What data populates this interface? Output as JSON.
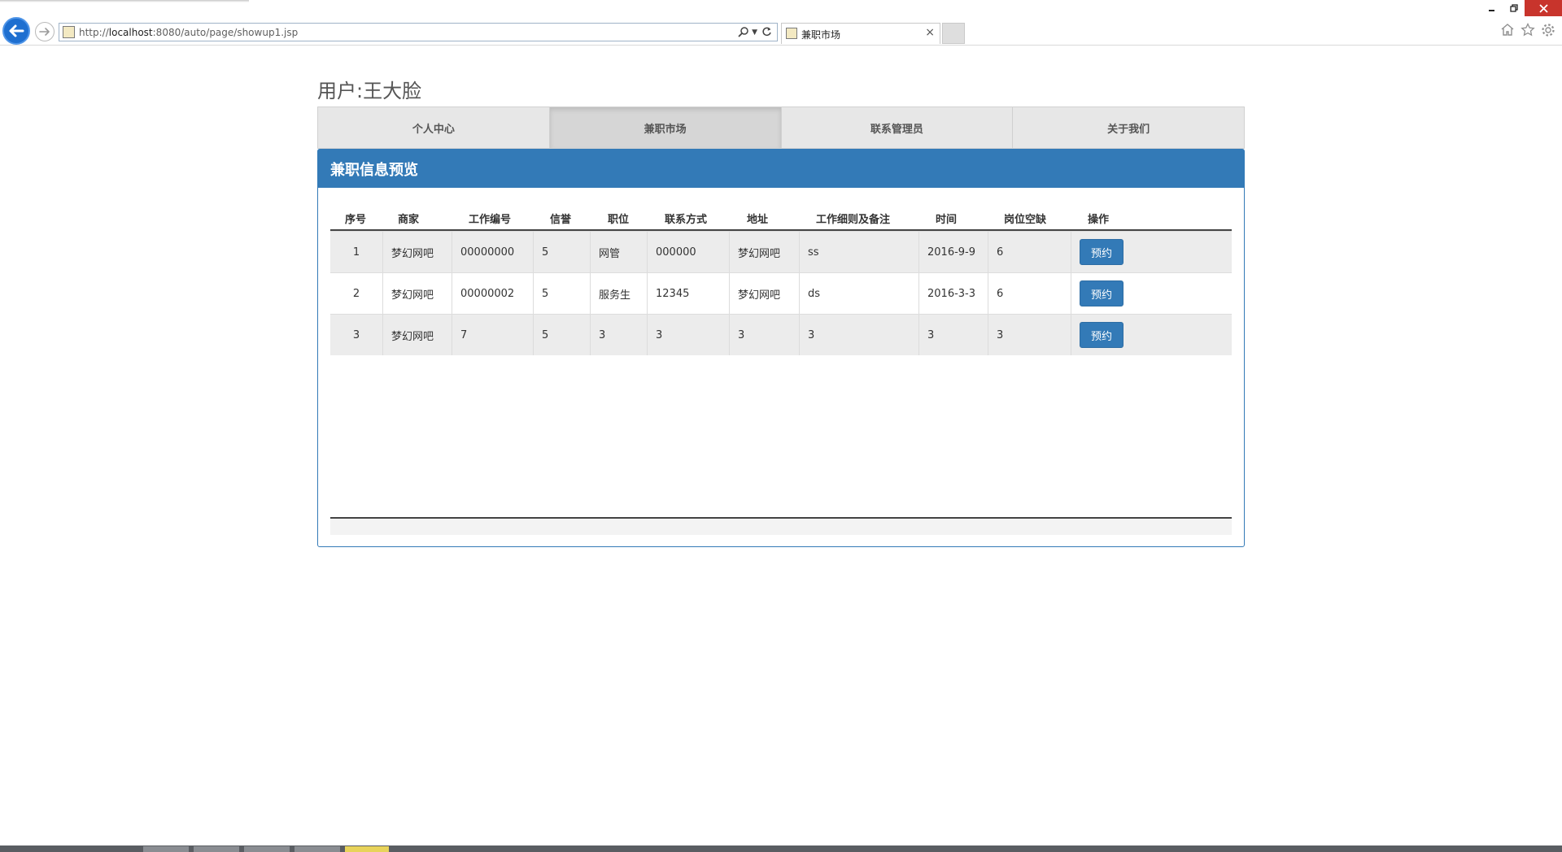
{
  "browser": {
    "url_prefix": "http://",
    "url_host": "localhost",
    "url_rest": ":8080/auto/page/showup1.jsp",
    "tab_title": "兼职市场",
    "tab_close": "×",
    "accent": "#1e6fd0"
  },
  "header": {
    "user_label": "用户:王大脸"
  },
  "nav": {
    "items": [
      {
        "label": "个人中心"
      },
      {
        "label": "兼职市场"
      },
      {
        "label": "联系管理员"
      },
      {
        "label": "关于我们"
      }
    ]
  },
  "panel": {
    "title": "兼职信息预览",
    "color": "#337ab7"
  },
  "table": {
    "columns": [
      "序号",
      "商家",
      "工作编号",
      "信誉",
      "职位",
      "联系方式",
      "地址",
      "工作细则及备注",
      "时间",
      "岗位空缺",
      "操作"
    ],
    "rows": [
      {
        "no": "1",
        "merchant": "梦幻网吧",
        "job_id": "00000000",
        "credit": "5",
        "position": "网管",
        "contact": "000000",
        "address": "梦幻网吧",
        "notes": "ss",
        "time": "2016-9-9",
        "vacancy": "6",
        "action": "预约"
      },
      {
        "no": "2",
        "merchant": "梦幻网吧",
        "job_id": "00000002",
        "credit": "5",
        "position": "服务生",
        "contact": "12345",
        "address": "梦幻网吧",
        "notes": "ds",
        "time": "2016-3-3",
        "vacancy": "6",
        "action": "预约"
      },
      {
        "no": "3",
        "merchant": "梦幻网吧",
        "job_id": "7",
        "credit": "5",
        "position": "3",
        "contact": "3",
        "address": "3",
        "notes": "3",
        "time": "3",
        "vacancy": "3",
        "action": "预约"
      }
    ]
  }
}
